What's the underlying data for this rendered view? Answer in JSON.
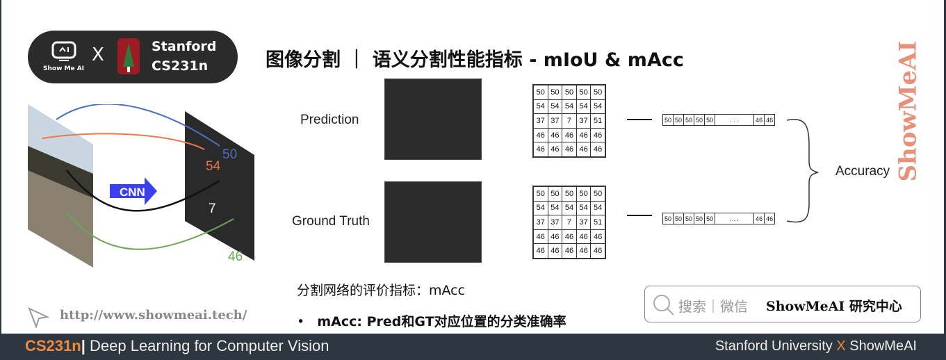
{
  "logo": {
    "showmeai": "Show Me AI",
    "x": "X",
    "stanford_line1": "Stanford",
    "stanford_line2": "CS231n"
  },
  "title": "图像分割 ｜ 语义分割性能指标 - mIoU & mAcc",
  "left_figure": {
    "network_label": "CNN",
    "class_labels": [
      {
        "value": "50",
        "color": "#4a6fc0"
      },
      {
        "value": "54",
        "color": "#e8774a"
      },
      {
        "value": "7",
        "color": "#ffffff"
      },
      {
        "value": "46",
        "color": "#6aa84f"
      }
    ]
  },
  "diagram": {
    "prediction_label": "Prediction",
    "ground_truth_label": "Ground Truth",
    "accuracy_label": "Accuracy",
    "prediction_matrix": [
      [
        "50",
        "50",
        "50",
        "50",
        "50"
      ],
      [
        "54",
        "54",
        "54",
        "54",
        "54"
      ],
      [
        "37",
        "37",
        "7",
        "37",
        "51"
      ],
      [
        "46",
        "46",
        "46",
        "46",
        "46"
      ],
      [
        "46",
        "46",
        "46",
        "46",
        "46"
      ]
    ],
    "ground_truth_matrix": [
      [
        "50",
        "50",
        "50",
        "50",
        "50"
      ],
      [
        "54",
        "54",
        "54",
        "54",
        "54"
      ],
      [
        "37",
        "37",
        "7",
        "37",
        "51"
      ],
      [
        "46",
        "46",
        "46",
        "46",
        "46"
      ],
      [
        "46",
        "46",
        "46",
        "46",
        "46"
      ]
    ],
    "vector": [
      "50",
      "50",
      "50",
      "50",
      "50",
      ". . .",
      "46",
      "46"
    ]
  },
  "notes": {
    "heading": "分割网络的评价指标：mAcc",
    "bullet": "mAcc: Pred和GT对应位置的分类准确率"
  },
  "url": "http://www.showmeai.tech/",
  "search_box": {
    "prefix": "搜索｜微信",
    "brand": "ShowMeAI 研究中心"
  },
  "watermark": "ShowMeAI",
  "footer": {
    "course": "CS231n",
    "separator": "|",
    "subtitle": "Deep Learning for Computer Vision",
    "right_a": "Stanford University",
    "right_x": "X",
    "right_b": "ShowMeAI"
  },
  "colors": {
    "accent_orange": "#f08a3c",
    "footer_bg": "#2e3640",
    "cnn_blue": "#3a3ff0"
  }
}
